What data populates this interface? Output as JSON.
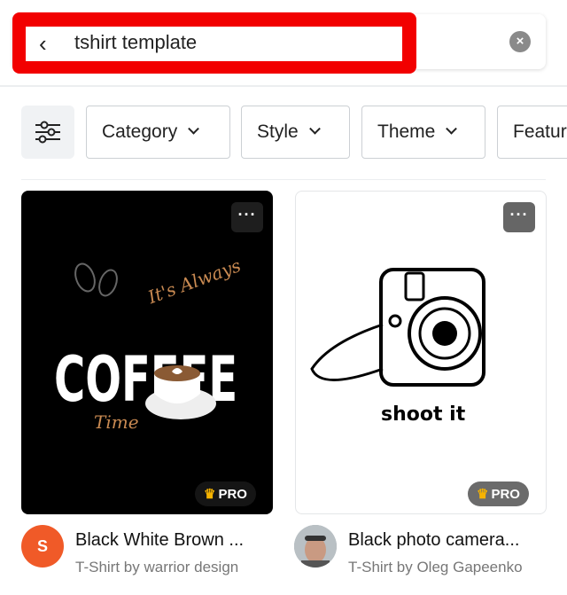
{
  "search": {
    "query": "tshirt template",
    "back_icon": "chevron-left-icon",
    "clear_icon": "close-circle-icon",
    "highlight_color": "#f20000"
  },
  "filters": {
    "icon": "sliders-icon",
    "chips": [
      {
        "label": "Category"
      },
      {
        "label": "Style"
      },
      {
        "label": "Theme"
      },
      {
        "label": "Featur"
      }
    ]
  },
  "results": [
    {
      "title": "Black White Brown ...",
      "subtitle": "T-Shirt by warrior design",
      "avatar_letter": "S",
      "avatar_color": "#f05a28",
      "badge": "PRO",
      "artwork_text": [
        "It's Always",
        "COFFEE",
        "Time"
      ]
    },
    {
      "title": "Black photo camera...",
      "subtitle": "T-Shirt by Oleg Gapeenko",
      "badge": "PRO",
      "artwork_text": [
        "shoot it"
      ]
    }
  ],
  "badge_crown_color": "#f6b300"
}
